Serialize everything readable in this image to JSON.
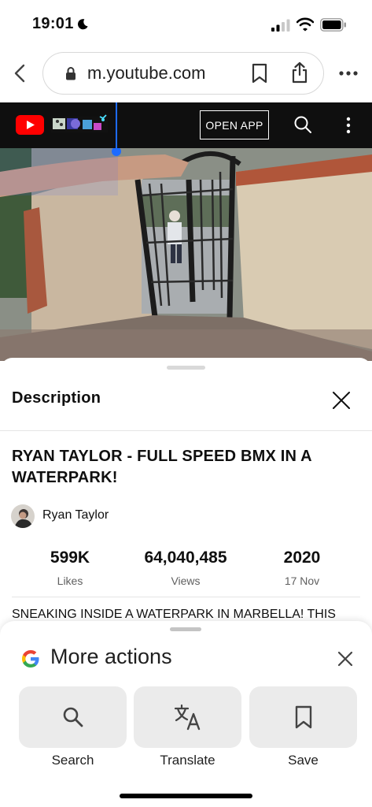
{
  "status_bar": {
    "time": "19:01"
  },
  "browser": {
    "url": "m.youtube.com"
  },
  "youtube": {
    "open_app_label": "OPEN APP"
  },
  "description_panel": {
    "title": "Description",
    "video_title": "RYAN TAYLOR - FULL SPEED BMX IN A WATERPARK!",
    "channel_name": "Ryan Taylor",
    "stats": [
      {
        "value": "599K",
        "label": "Likes"
      },
      {
        "value": "64,040,485",
        "label": "Views"
      },
      {
        "value": "2020",
        "label": "17 Nov"
      }
    ],
    "description_text": "SNEAKING INSIDE A WATERPARK IN MARBELLA! THIS"
  },
  "more_actions": {
    "title": "More actions",
    "actions": [
      {
        "label": "Search",
        "icon": "search-icon"
      },
      {
        "label": "Translate",
        "icon": "translate-icon"
      },
      {
        "label": "Save",
        "icon": "bookmark-icon"
      }
    ]
  },
  "colors": {
    "youtube_red": "#ff0000",
    "header_black": "#0f0f0f",
    "tile_gray": "#ebebeb"
  }
}
